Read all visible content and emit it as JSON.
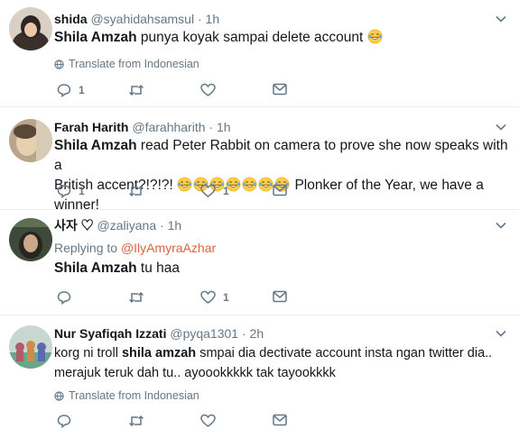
{
  "translate_label": "Translate from Indonesian",
  "tweets": [
    {
      "name": "shida",
      "handle": "@syahidahsamsul",
      "separator": "·",
      "time": "1h",
      "mention": "Shila Amzah",
      "text": "punya koyak sampai delete account",
      "emoji": [
        "face-with-tears-of-joy"
      ],
      "reply_count": "1",
      "like_count": ""
    },
    {
      "name": "Farah Harith",
      "handle": "@farahharith",
      "separator": "·",
      "time": "1h",
      "mention": "Shila Amzah",
      "text_line1": "read Peter Rabbit on camera to prove she now speaks with a",
      "text_line2a": "British accent?!?!?!",
      "text_line2b": "Plonker of the Year, we have a winner!",
      "emoji": [
        "face-with-tears-of-joy",
        "face-with-tears-of-joy",
        "face-with-tears-of-joy",
        "face-with-tears-of-joy",
        "face-with-tears-of-joy",
        "face-with-tears-of-joy",
        "face-with-tears-of-joy"
      ],
      "reply_count": "1",
      "like_count": "1"
    },
    {
      "name": "사자 ♡",
      "handle": "@zaliyana",
      "separator": "·",
      "time": "1h",
      "replying_prefix": "Replying to",
      "replying_handle": "@IlyAmyraAzhar",
      "mention": "Shila Amzah",
      "text": "tu haa",
      "reply_count": "",
      "like_count": "1"
    },
    {
      "name": "Nur Syafiqah Izzati",
      "handle": "@pyqa1301",
      "separator": "·",
      "time": "2h",
      "text_line1a": "korg ni troll",
      "mention": "shila amzah",
      "text_line1b": "smpai dia dectivate account insta ngan twitter dia..",
      "text_line2": "merajuk teruk dah tu.. ayoookkkkk tak tayookkkk",
      "reply_count": "",
      "like_count": ""
    }
  ],
  "colors": {
    "name": "#14171a",
    "secondary": "#657786",
    "link": "#e0623a",
    "divider": "#e6ecf0"
  }
}
